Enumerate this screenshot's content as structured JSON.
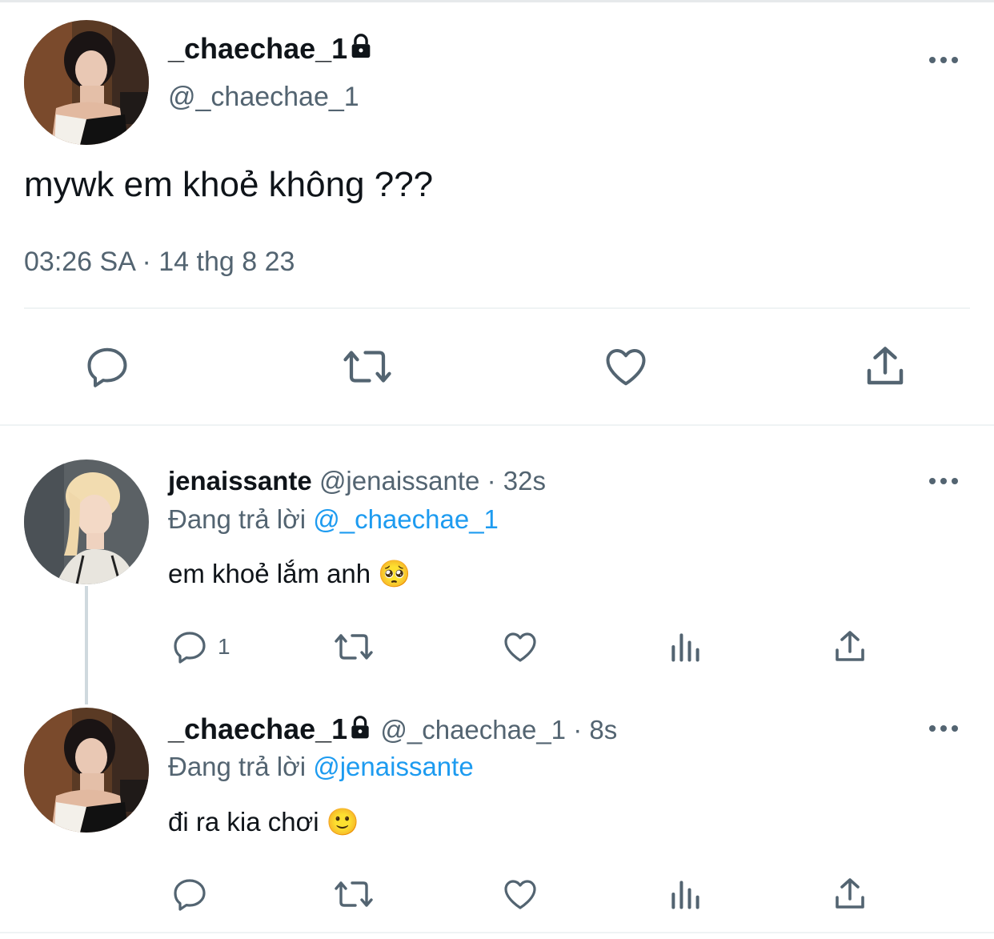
{
  "main_tweet": {
    "display_name": "_chaechae_1",
    "handle": "@_chaechae_1",
    "text": "mywk em khoẻ không ???",
    "time": "03:26 SA",
    "separator": "·",
    "date": "14 thg 8 23"
  },
  "replies": [
    {
      "display_name": "jenaissante",
      "handle": "@jenaissante",
      "age": "32s",
      "replying_prefix": "Đang trả lời",
      "replying_to": "@_chaechae_1",
      "text": "em khoẻ lắm anh",
      "emoji": "🥺",
      "reply_count": "1"
    },
    {
      "display_name": "_chaechae_1",
      "handle": "@_chaechae_1",
      "age": "8s",
      "replying_prefix": "Đang trả lời",
      "replying_to": "@jenaissante",
      "text": "đi ra kia chơi",
      "emoji": "🙂",
      "reply_count": ""
    }
  ],
  "icons": {
    "reply": "reply-icon",
    "retweet": "retweet-icon",
    "like": "like-icon",
    "views": "views-icon",
    "share": "share-icon",
    "more": "more-icon",
    "lock": "lock-icon"
  },
  "colors": {
    "text": "#0f1419",
    "secondary": "#536471",
    "link": "#1d9bf0",
    "divider": "#eff3f4"
  }
}
